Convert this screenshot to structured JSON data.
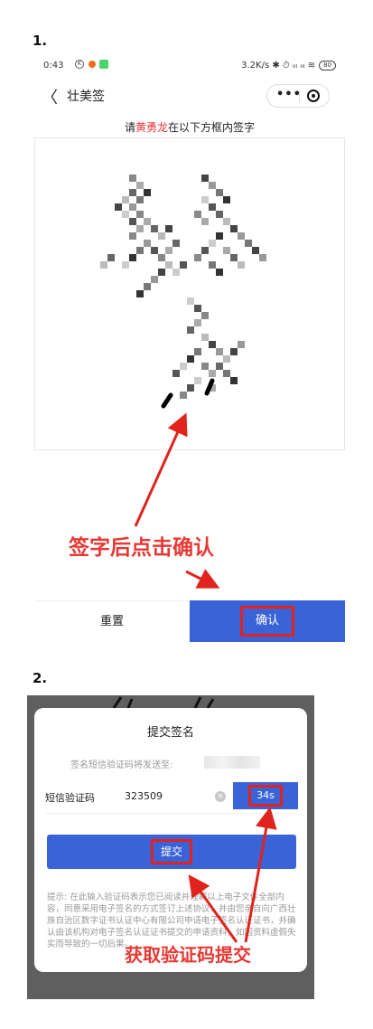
{
  "steps": {
    "step1": "1.",
    "step2": "2."
  },
  "status_bar": {
    "time": "0:43",
    "right": "3.2K/s ✱ ⏱ ᵢᵢₗ ᵢᵢₗ ≋",
    "battery": "80"
  },
  "navbar": {
    "back_icon": "back-chevron",
    "title": "壮美签",
    "more_icon": "more-dots",
    "target_icon": "circle-target"
  },
  "signing": {
    "prefix": "请",
    "signer_name": "黄勇龙",
    "suffix": "在以下方框内签字",
    "name_color": "#e53935"
  },
  "annotation1": "签字后点击确认",
  "actions": {
    "reset_label": "重置",
    "confirm_label": "确认",
    "accent_color": "#3b63d8",
    "highlight_color": "#e0231c"
  },
  "modal": {
    "title": "提交签名",
    "send_hint": "签名短信验证码将发送至:",
    "code_label": "短信验证码",
    "code_value": "323509",
    "clear_icon": "clear-x",
    "countdown": "34s",
    "submit_label": "提交",
    "note": "提示: 在此输入验证码表示您已阅读并理解以上电子文件全部内容，同意采用电子签名的方式签订上述协议，并由您亲自向广西壮族自治区数字证书认证中心有限公司申请电子签名认证证书，并确认由该机构对电子签名认证证书提交的申请资料，如因资料虚假失实而导致的一切后果。"
  },
  "annotation2": "获取验证码提交"
}
